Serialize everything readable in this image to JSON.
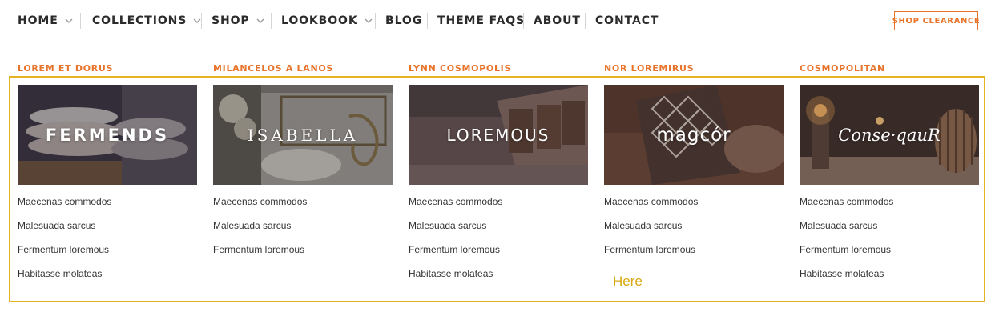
{
  "nav": {
    "items": [
      {
        "label": "HOME",
        "dropdown": true
      },
      {
        "label": "COLLECTIONS",
        "dropdown": true
      },
      {
        "label": "SHOP",
        "dropdown": true
      },
      {
        "label": "LOOKBOOK",
        "dropdown": true
      },
      {
        "label": "BLOG",
        "dropdown": false
      },
      {
        "label": "THEME FAQS",
        "dropdown": false
      },
      {
        "label": "ABOUT",
        "dropdown": false
      },
      {
        "label": "CONTACT",
        "dropdown": false
      }
    ],
    "cta_label": "SHOP CLEARANCE"
  },
  "mega_menu": {
    "columns": [
      {
        "title": "LOREM ET DORUS",
        "banner_label": "FERMENDS",
        "links": [
          "Maecenas commodos",
          "Malesuada sarcus",
          "Fermentum loremous",
          "Habitasse molateas"
        ]
      },
      {
        "title": "MILANCELOS A LANOS",
        "banner_label": "ISABELLA",
        "links": [
          "Maecenas commodos",
          "Malesuada sarcus",
          "Fermentum loremous"
        ]
      },
      {
        "title": "LYNN COSMOPOLIS",
        "banner_label": "LOREMOUS",
        "links": [
          "Maecenas commodos",
          "Malesuada sarcus",
          "Fermentum loremous",
          "Habitasse molateas"
        ]
      },
      {
        "title": "NOR LOREMIRUS",
        "banner_label": "magcór",
        "links": [
          "Maecenas commodos",
          "Malesuada sarcus",
          "Fermentum loremous"
        ]
      },
      {
        "title": "COSMOPOLITAN",
        "banner_label": "Conse·qauR",
        "links": [
          "Maecenas commodos",
          "Malesuada sarcus",
          "Fermentum loremous",
          "Habitasse molateas"
        ]
      }
    ]
  },
  "annotation": {
    "text": "Here"
  },
  "colors": {
    "accent": "#e8742c",
    "highlight": "#e6b422",
    "text": "#2b2b2b"
  },
  "icons": {
    "dropdown": "chevron-down-icon"
  }
}
